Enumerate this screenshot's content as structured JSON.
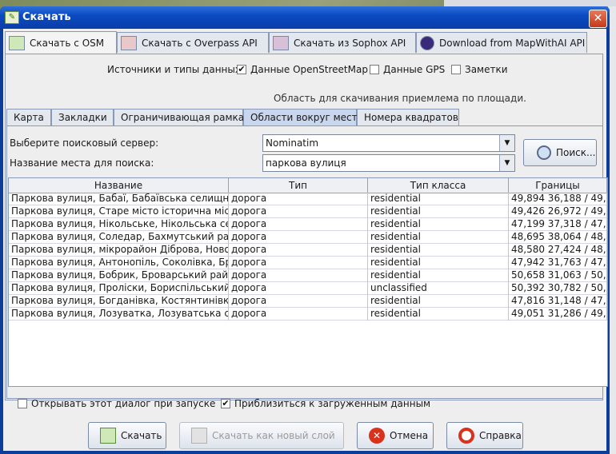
{
  "window": {
    "title": "Скачать"
  },
  "top_tabs": [
    {
      "label": "Скачать с OSM",
      "active": true
    },
    {
      "label": "Скачать с Overpass API",
      "active": false
    },
    {
      "label": "Скачать из Sophox API",
      "active": false
    },
    {
      "label": "Download from MapWithAI API",
      "active": false
    }
  ],
  "sources": {
    "label": "Источники и типы данных:",
    "options": [
      {
        "label": "Данные OpenStreetMap",
        "checked": true
      },
      {
        "label": "Данные GPS",
        "checked": false
      },
      {
        "label": "Заметки",
        "checked": false
      }
    ]
  },
  "area_note": "Область для скачивания приемлема по площади.",
  "sub_tabs": [
    {
      "label": "Карта",
      "active": false
    },
    {
      "label": "Закладки",
      "active": false
    },
    {
      "label": "Ограничивающая рамка",
      "active": false
    },
    {
      "label": "Области вокруг мест",
      "active": true
    },
    {
      "label": "Номера квадратов",
      "active": false
    }
  ],
  "search": {
    "server_label": "Выберите поисковый сервер:",
    "server_value": "Nominatim",
    "place_label": "Название места для поиска:",
    "place_value": "паркова вулиця",
    "search_button": "Поиск..."
  },
  "table": {
    "columns": [
      "Название",
      "Тип",
      "Тип класса",
      "Границы"
    ],
    "rows": [
      [
        "Паркова вулиця, Бабаї, Бабаївська селищна...",
        "дорога",
        "residential",
        "49,894 36,188 / 49,..."
      ],
      [
        "Паркова вулиця, Старе місто історична місц...",
        "дорога",
        "residential",
        "49,426 26,972 / 49,..."
      ],
      [
        "Паркова вулиця, Нікольське, Нікольська се...",
        "дорога",
        "residential",
        "47,199 37,318 / 47,..."
      ],
      [
        "Паркова вулиця, Соледар, Бахмутський рай...",
        "дорога",
        "residential",
        "48,695 38,064 / 48,..."
      ],
      [
        "Паркова вулиця, мікрорайон Діброва, Новод...",
        "дорога",
        "residential",
        "48,580 27,424 / 48,..."
      ],
      [
        "Паркова вулиця, Антонопіль, Соколівка, Бра...",
        "дорога",
        "residential",
        "47,942 31,763 / 47,..."
      ],
      [
        "Паркова вулиця, Бобрик, Броварський рай...",
        "дорога",
        "residential",
        "50,658 31,063 / 50,..."
      ],
      [
        "Паркова вулиця, Проліски, Бориспільський ...",
        "дорога",
        "unclassified",
        "50,392 30,782 / 50,..."
      ],
      [
        "Паркова вулиця, Богданівка, Костянтинівка, ...",
        "дорога",
        "residential",
        "47,816 31,148 / 47,..."
      ],
      [
        "Паркова вулиця, Лозуватка, Лозуватська сіл...",
        "дорога",
        "residential",
        "49,051 31,286 / 49,..."
      ]
    ]
  },
  "options": {
    "open_on_start": {
      "label": "Открывать этот диалог при запуске",
      "checked": false
    },
    "zoom_to_data": {
      "label": "Приблизиться к загруженным данным",
      "checked": true
    }
  },
  "buttons": {
    "download": "Скачать",
    "download_new_layer": "Скачать как новый слой",
    "cancel": "Отмена",
    "help": "Справка"
  }
}
